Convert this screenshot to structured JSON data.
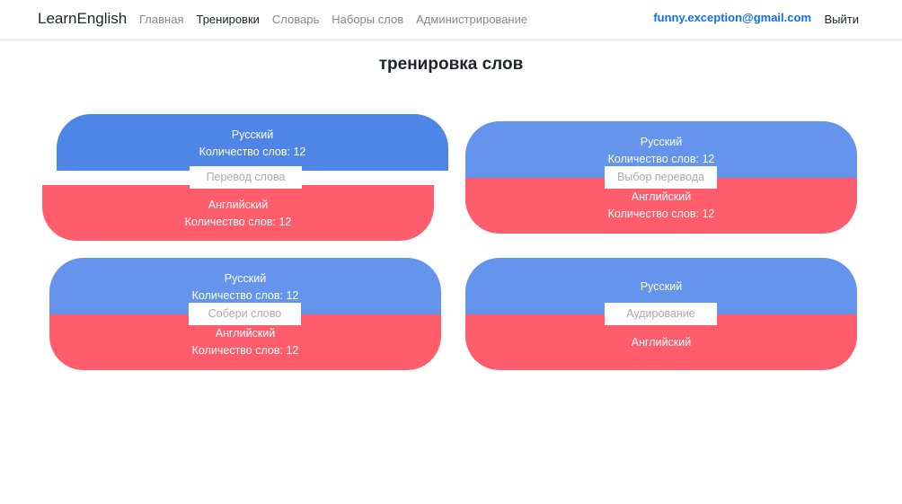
{
  "navbar": {
    "brand": "LearnEnglish",
    "links": [
      {
        "label": "Главная",
        "active": false
      },
      {
        "label": "Тренировки",
        "active": true
      },
      {
        "label": "Словарь",
        "active": false
      },
      {
        "label": "Наборы слов",
        "active": false
      },
      {
        "label": "Администрирование",
        "active": false
      }
    ],
    "user_email": "funny.exception@gmail.com",
    "logout_label": "Выйти"
  },
  "page_title": "тренировка слов",
  "colors": {
    "blue": "#6494eb",
    "blue_dark": "#4e85e6",
    "red": "#ff5c6c",
    "link": "#0d6efd"
  },
  "trainings": [
    {
      "top_lang": "Русский",
      "top_count": "Количество слов: 12",
      "mode": "Перевод слова",
      "bottom_lang": "Английский",
      "bottom_count": "Количество слов: 12"
    },
    {
      "top_lang": "Русский",
      "top_count": "Количество слов: 12",
      "mode": "Выбор перевода",
      "bottom_lang": "Английский",
      "bottom_count": "Количество слов: 12"
    },
    {
      "top_lang": "Русский",
      "top_count": "Количество слов: 12",
      "mode": "Собери слово",
      "bottom_lang": "Английский",
      "bottom_count": "Количество слов: 12"
    },
    {
      "top_lang": "Русский",
      "mode": "Аудирование",
      "bottom_lang": "Английский"
    }
  ]
}
